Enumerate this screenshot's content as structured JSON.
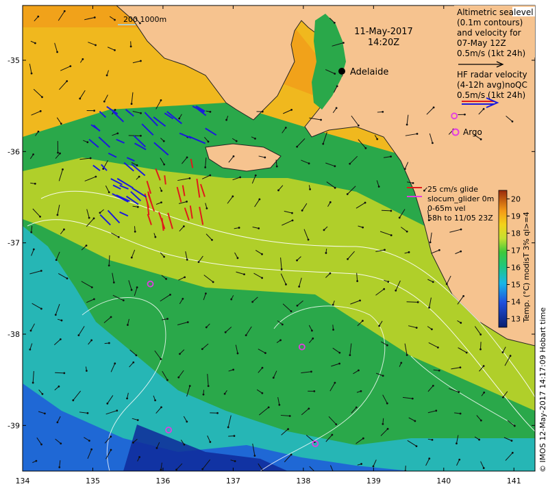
{
  "map": {
    "date": "11-May-2017",
    "time": "14:20Z",
    "city": "Adelaide",
    "argo_label": "Argo",
    "depth_contours": "200  1000m",
    "altimetry_legend": [
      "Altimetric sealevel",
      "(0.1m contours)",
      "and velocity for",
      "07-May 12Z",
      "0.5m/s (1kt 24h)"
    ],
    "hf_radar_legend": [
      "HF radar velocity",
      "(4-12h avg)noQC",
      "0.5m/s (1kt 24h)"
    ],
    "glider_legend": [
      "25 cm/s glide",
      "slocum_glider 0m",
      "0-65m vel",
      "58h to 11/05 23Z"
    ],
    "colorbar": {
      "label": "Temp. (°C) modisT 3% ql>=4",
      "ticks": [
        "20",
        "19",
        "18",
        "17",
        "16",
        "15",
        "14",
        "13"
      ],
      "range": [
        12.5,
        20.5
      ]
    },
    "credit": "© IMOS 12-May-2017 14:17:09 Hobart time",
    "lon_ticks": [
      "134",
      "135",
      "136",
      "137",
      "138",
      "139",
      "140",
      "141"
    ],
    "lat_ticks": [
      "-35",
      "-36",
      "-37",
      "-38",
      "-39"
    ],
    "lon_range": [
      134,
      141.3
    ],
    "lat_range": [
      -39.5,
      -34.4
    ],
    "colors": {
      "land": "#f6c38f",
      "hf_radar_blue": "#1a1adc",
      "hf_radar_red": "#e01a1a",
      "argo": "#e23ce2",
      "contour": "#ffffff"
    }
  }
}
